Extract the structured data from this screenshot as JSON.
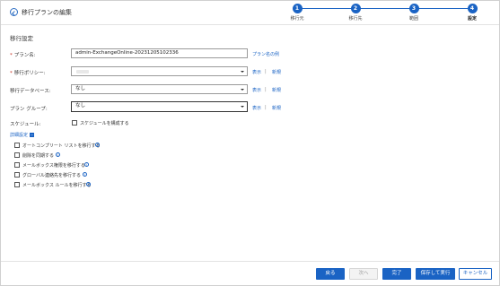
{
  "header": {
    "title": "移行プランの編集",
    "steps": [
      {
        "number": "1",
        "label": "移行元"
      },
      {
        "number": "2",
        "label": "移行先"
      },
      {
        "number": "3",
        "label": "範囲"
      },
      {
        "number": "4",
        "label": "設定"
      }
    ]
  },
  "form": {
    "section_title": "移行設定",
    "plan_name": {
      "label": "プラン名:",
      "value": "admin-ExchangeOnline-20231205102336",
      "example_link": "プラン名の例"
    },
    "migration_policy": {
      "label": "移行ポリシー:",
      "value": "",
      "view_link": "表示",
      "separator": "|",
      "new_link": "新規"
    },
    "migration_database": {
      "label": "移行データベース:",
      "value": "なし",
      "view_link": "表示",
      "separator": "|",
      "new_link": "新規"
    },
    "plan_group": {
      "label": "プラン グループ:",
      "value": "なし",
      "view_link": "表示",
      "separator": "|",
      "new_link": "新規"
    },
    "schedule": {
      "label": "スケジュール:",
      "checkbox_label": "スケジュールを構成する"
    },
    "advanced": {
      "label": "詳細設定",
      "toggle": "−",
      "options": [
        {
          "label": "オートコンプリート リストを移行する"
        },
        {
          "label": "削除を同期する"
        },
        {
          "label": "メールボックス権限を移行する"
        },
        {
          "label": "グローバル連絡先を移行する"
        },
        {
          "label": "メールボックス ルールを移行する"
        }
      ]
    }
  },
  "footer": {
    "back": "戻る",
    "next": "次へ",
    "finish": "完了",
    "save_run": "保存して実行",
    "cancel": "キャンセル"
  },
  "colors": {
    "accent": "#1a63c4",
    "required": "#c42b1c"
  }
}
